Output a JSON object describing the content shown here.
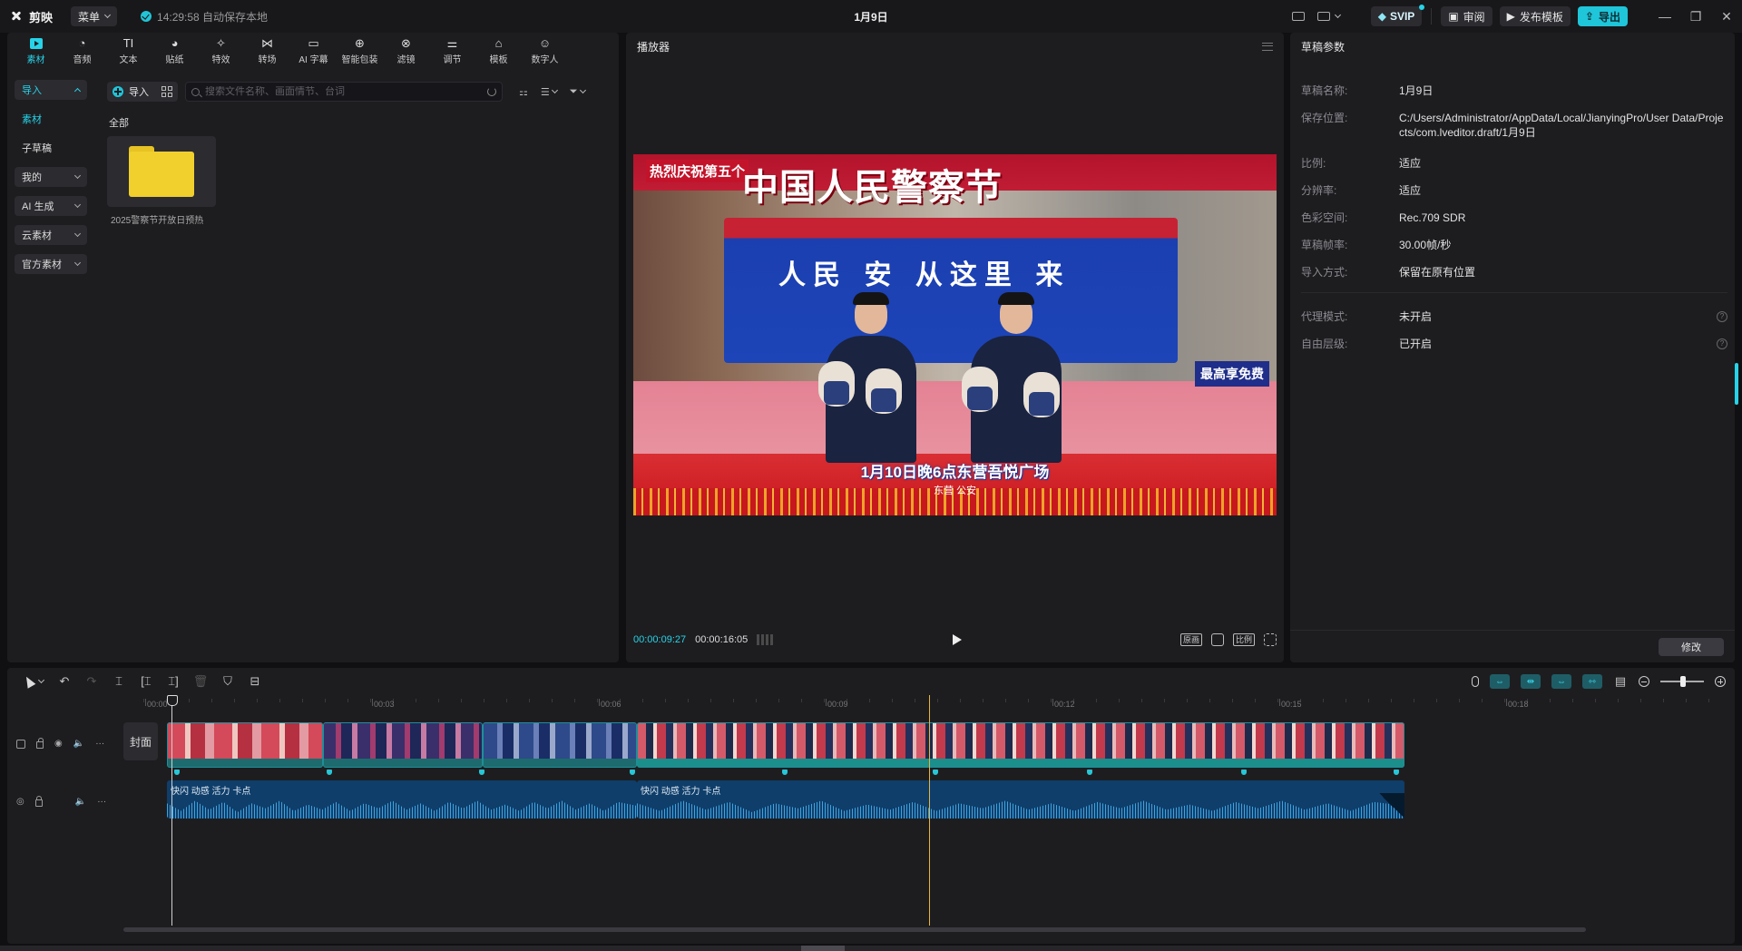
{
  "titlebar": {
    "app_name": "剪映",
    "menu_label": "菜单",
    "save_status": "14:29:58 自动保存本地",
    "project_title": "1月9日",
    "svip_label": "SVIP",
    "review_label": "审阅",
    "publish_label": "发布模板",
    "export_label": "导出"
  },
  "media_tabs": [
    {
      "label": "素材",
      "icon": "media-icon"
    },
    {
      "label": "音频",
      "icon": "audio-icon"
    },
    {
      "label": "文本",
      "icon": "text-icon"
    },
    {
      "label": "贴纸",
      "icon": "sticker-icon"
    },
    {
      "label": "特效",
      "icon": "effects-icon"
    },
    {
      "label": "转场",
      "icon": "transition-icon"
    },
    {
      "label": "AI 字幕",
      "icon": "ai-caption-icon"
    },
    {
      "label": "智能包装",
      "icon": "smart-package-icon"
    },
    {
      "label": "滤镜",
      "icon": "filter-icon"
    },
    {
      "label": "调节",
      "icon": "adjust-icon"
    },
    {
      "label": "模板",
      "icon": "template-icon"
    },
    {
      "label": "数字人",
      "icon": "digital-human-icon"
    }
  ],
  "media_sidebar": {
    "import_label": "导入",
    "items": [
      "素材",
      "子草稿",
      "我的",
      "AI 生成",
      "云素材",
      "官方素材"
    ]
  },
  "media_toolbar": {
    "import_button": "导入",
    "search_placeholder": "搜索文件名称、画面情节、台词"
  },
  "media_content": {
    "section_label": "全部",
    "folder_name": "2025警察节开放日预热"
  },
  "player": {
    "title": "播放器",
    "current_time": "00:00:09:27",
    "total_time": "00:00:16:05",
    "btn_original": "原画",
    "btn_ratio": "比例",
    "video": {
      "banner": "热烈庆祝第五个",
      "headline": "中国人民警察节",
      "stage_text": "人民  安  从这里 来",
      "caption": "1月10日晚6点东营吾悦广场",
      "subcaption": "东营 公安",
      "side_sign": "最高享免费"
    }
  },
  "params": {
    "title": "草稿参数",
    "rows": [
      {
        "key": "草稿名称:",
        "value": "1月9日"
      },
      {
        "key": "保存位置:",
        "value": "C:/Users/Administrator/AppData/Local/JianyingPro/User Data/Projects/com.lveditor.draft/1月9日"
      },
      {
        "key": "比例:",
        "value": "适应"
      },
      {
        "key": "分辨率:",
        "value": "适应"
      },
      {
        "key": "色彩空间:",
        "value": "Rec.709 SDR"
      },
      {
        "key": "草稿帧率:",
        "value": "30.00帧/秒"
      },
      {
        "key": "导入方式:",
        "value": "保留在原有位置"
      }
    ],
    "extra_rows": [
      {
        "key": "代理模式:",
        "value": "未开启"
      },
      {
        "key": "自由层级:",
        "value": "已开启"
      }
    ],
    "modify_label": "修改"
  },
  "timeline": {
    "cover_label": "封面",
    "ruler": [
      "00:00",
      "00:03",
      "00:06",
      "00:09",
      "00:12",
      "00:15",
      "00:18"
    ],
    "audio_clip_1": "快闪 动感 活力 卡点",
    "audio_clip_2": "快闪 动感 活力 卡点"
  }
}
